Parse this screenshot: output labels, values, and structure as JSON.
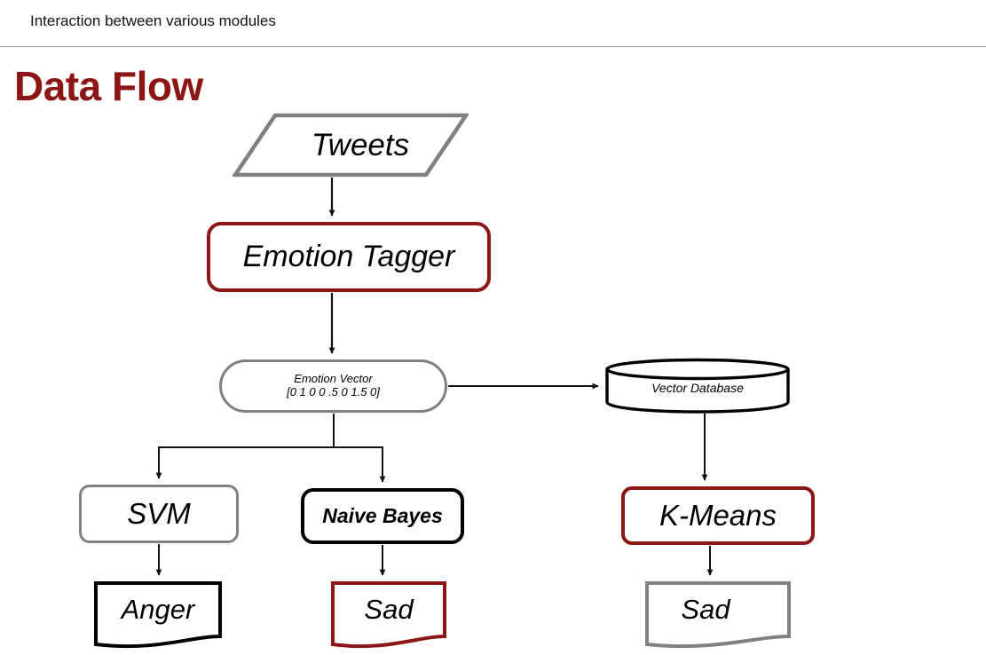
{
  "header": {
    "text": "Interaction between various modules"
  },
  "title": {
    "text": "Data Flow"
  },
  "colors": {
    "dark_red": "#8C1515",
    "gray": "#808080",
    "black": "#000000",
    "header_rule": "#9A9A9A"
  },
  "nodes": {
    "tweets": {
      "label": "Tweets",
      "shape": "parallelogram",
      "outline_color": "#808080"
    },
    "emotion_tagger": {
      "label": "Emotion Tagger",
      "shape": "rounded-rectangle",
      "outline_color": "#8C1515"
    },
    "emotion_vector": {
      "label_line1": "Emotion Vector",
      "label_line2": "[0 1 0 0 .5 0 1.5 0]",
      "shape": "stadium",
      "outline_color": "#808080"
    },
    "vector_database": {
      "label": "Vector Database",
      "shape": "cylinder",
      "outline_color": "#000000"
    },
    "svm": {
      "label": "SVM",
      "shape": "rounded-rectangle",
      "outline_color": "#808080"
    },
    "naive_bayes": {
      "label": "Naive Bayes",
      "shape": "rounded-rectangle",
      "outline_color": "#000000"
    },
    "kmeans": {
      "label": "K-Means",
      "shape": "rounded-rectangle",
      "outline_color": "#8C1515"
    },
    "output_anger": {
      "label": "Anger",
      "shape": "document",
      "outline_color": "#000000"
    },
    "output_sad_nb": {
      "label": "Sad",
      "shape": "document",
      "outline_color": "#8C1515"
    },
    "output_sad_km": {
      "label": "Sad",
      "shape": "document",
      "outline_color": "#808080"
    }
  },
  "connectors": [
    {
      "name": "tweets-to-emotion-tagger",
      "from": "tweets",
      "to": "emotion_tagger"
    },
    {
      "name": "emotion-tagger-to-emotion-vector",
      "from": "emotion_tagger",
      "to": "emotion_vector"
    },
    {
      "name": "emotion-vector-to-vector-database",
      "from": "emotion_vector",
      "to": "vector_database"
    },
    {
      "name": "emotion-vector-to-svm",
      "from": "emotion_vector",
      "to": "svm"
    },
    {
      "name": "emotion-vector-to-naive-bayes",
      "from": "emotion_vector",
      "to": "naive_bayes"
    },
    {
      "name": "vector-database-to-kmeans",
      "from": "vector_database",
      "to": "kmeans"
    },
    {
      "name": "svm-to-anger",
      "from": "svm",
      "to": "output_anger"
    },
    {
      "name": "naive-bayes-to-sad",
      "from": "naive_bayes",
      "to": "output_sad_nb"
    },
    {
      "name": "kmeans-to-sad",
      "from": "kmeans",
      "to": "output_sad_km"
    }
  ]
}
